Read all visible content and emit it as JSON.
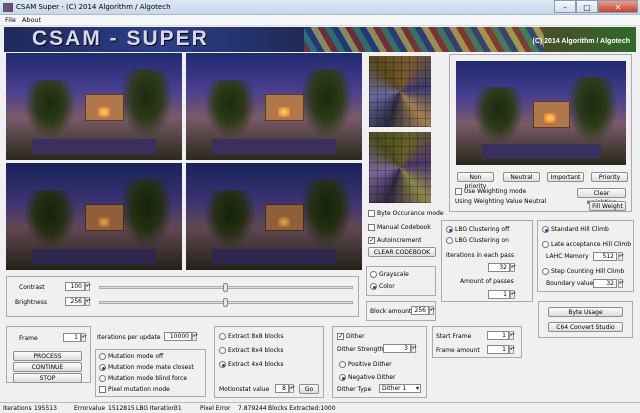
{
  "window": {
    "title": "CSAM Super - (C) 2014 Algorithm / Algotech",
    "min": "–",
    "max": "□",
    "close": "✕"
  },
  "menu": {
    "file": "File",
    "about": "About"
  },
  "banner": {
    "title": "CSAM - SUPER",
    "copyright": "(C) 2014 Algorithm / Algotech"
  },
  "priority": {
    "non_priority": "Non priority",
    "neutral": "Neutral",
    "important": "Important",
    "priority": "Priority"
  },
  "weighting": {
    "use_label": "Use Weighting mode",
    "value_text": "Using Weighting Value Neutral",
    "clear": "Clear weighting",
    "fill": "Fill Weight"
  },
  "codebook": {
    "byte_occurance": "Byte Occurance mode",
    "manual": "Manual Codebook",
    "autoincrement": "Autoincrement",
    "clear": "CLEAR CODEBOOK"
  },
  "lbg": {
    "off": "LBG Clustering off",
    "on": "LBG Clustering on",
    "iterations_label": "Iterations in each pass",
    "iterations": "32",
    "passes_label": "Amount of passes",
    "passes": "1"
  },
  "hill": {
    "standard": "Standard Hill Climb",
    "late": "Late acceptance Hill Climb",
    "lahc_label": "LAHC Memory",
    "lahc": "512",
    "step": "Step Counting Hill Climb",
    "boundary_label": "Boundary value",
    "boundary": "32"
  },
  "color": {
    "grayscale": "Grayscale",
    "color": "Color"
  },
  "block": {
    "label": "Block amount",
    "value": "256"
  },
  "adjust": {
    "contrast_label": "Contrast",
    "contrast": "100",
    "brightness_label": "Brightness",
    "brightness": "256",
    "contrast_pos": 0.5,
    "brightness_pos": 0.5
  },
  "frame": {
    "label": "Frame",
    "value": "1",
    "process": "PROCESS",
    "continue": "CONTINUE",
    "stop": "STOP"
  },
  "mutation": {
    "iter_label": "Iterations per update",
    "iter": "10000",
    "off": "Mutation mode off",
    "mate": "Mutation mode mate closest",
    "blind": "Mutation mode blind force",
    "pixel": "Pixel mutation mode"
  },
  "extract": {
    "b8": "Extract 8x8 blocks",
    "b84": "Extract 8x4 blocks",
    "b44": "Extract 4x4 blocks",
    "motion_label": "Motionstat value",
    "motion": "8",
    "go": "Go"
  },
  "dither": {
    "dither": "Dither",
    "strength_label": "Dither Strength",
    "strength": "3",
    "positive": "Positive Dither",
    "negative": "Negative Dither",
    "type_label": "Dither Type",
    "type": "Dither 1"
  },
  "startframe": {
    "label": "Start Frame",
    "value": "1",
    "amount_label": "Frame amount",
    "amount": "1"
  },
  "tools": {
    "byte_usage": "Byte Usage",
    "c64": "C64 Convert Studio"
  },
  "status": {
    "iterations": "Iterations",
    "iterations_val": "195513",
    "errorvalue": "Errorvalue",
    "errorvalue_val": "1512815",
    "lbg": "LBG Iteration",
    "lbg_val": "31",
    "pixel": "Pixel Error",
    "pixel_val": "7.879244",
    "blocks": "Blocks Extracted:1000"
  }
}
